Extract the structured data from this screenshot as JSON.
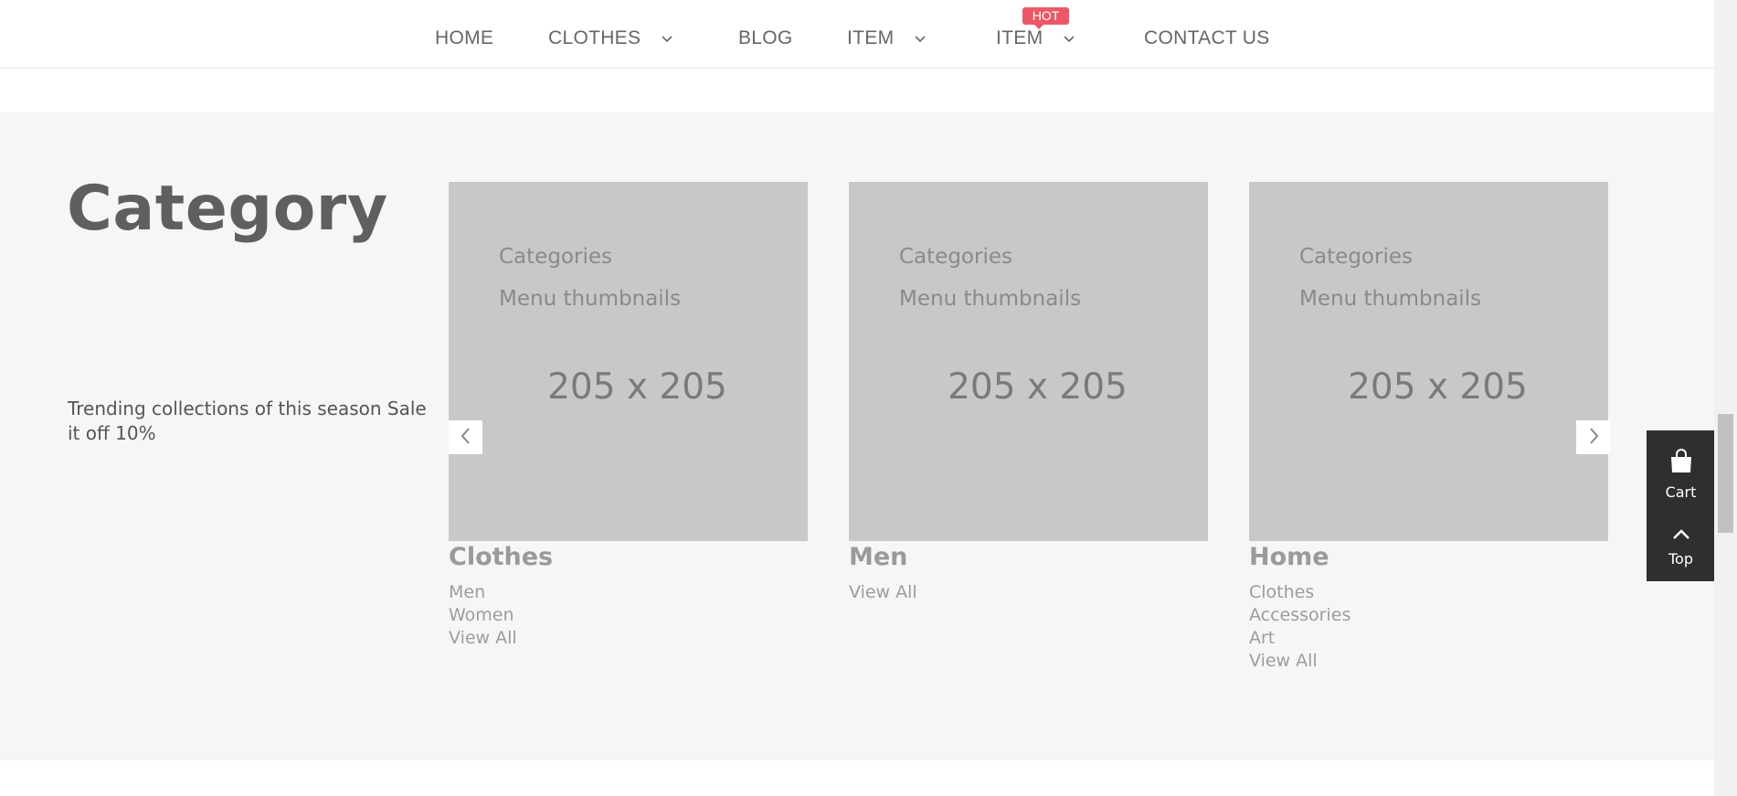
{
  "nav": {
    "items": [
      {
        "label": "HOME",
        "dropdown": false
      },
      {
        "label": "CLOTHES",
        "dropdown": true
      },
      {
        "label": "BLOG",
        "dropdown": false
      },
      {
        "label": "ITEM",
        "dropdown": true
      },
      {
        "label": "ITEM",
        "dropdown": true
      },
      {
        "label": "CONTACT US",
        "dropdown": false
      }
    ],
    "hot_badge": "HOT"
  },
  "category": {
    "title": "Category",
    "description": "Trending collections of this season Sale it off 10%",
    "cards": [
      {
        "thumb_line1": "Categories",
        "thumb_line2": "Menu thumbnails",
        "thumb_size": "205 x 205",
        "title": "Clothes",
        "links": [
          "Men",
          "Women",
          "View All"
        ]
      },
      {
        "thumb_line1": "Categories",
        "thumb_line2": "Menu thumbnails",
        "thumb_size": "205 x 205",
        "title": "Men",
        "links": [
          "View All"
        ]
      },
      {
        "thumb_line1": "Categories",
        "thumb_line2": "Menu thumbnails",
        "thumb_size": "205 x 205",
        "title": "Home",
        "links": [
          "Clothes",
          "Accessories",
          "Art",
          "View All"
        ]
      }
    ]
  },
  "widgets": {
    "cart_label": "Cart",
    "top_label": "Top"
  },
  "icons": {
    "prev": "chevron-left-icon",
    "next": "chevron-right-icon",
    "cart": "shopping-bag-icon",
    "top": "chevron-up-icon",
    "dropdown": "chevron-down-icon"
  },
  "colors": {
    "hot_badge": "#ec5867",
    "section_bg": "#f6f6f6",
    "thumb_bg": "#c8c8c8",
    "float_panel": "#2f2f2f"
  }
}
